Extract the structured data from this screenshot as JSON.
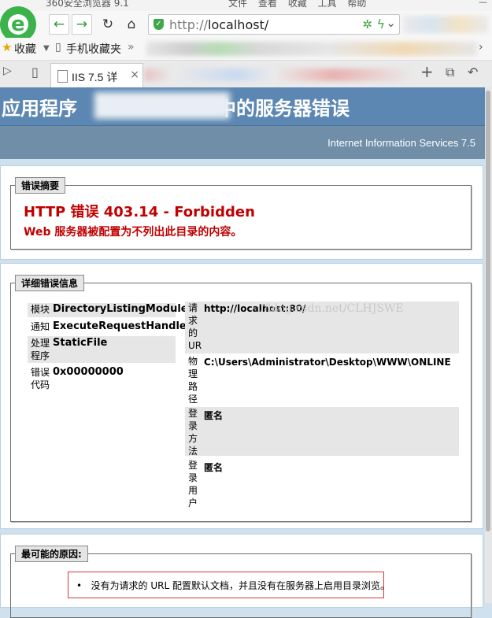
{
  "browser": {
    "title": "360安全浏览器 9.1",
    "menu": [
      "文件",
      "查看",
      "收藏",
      "工具",
      "帮助"
    ],
    "logo_letter": "e",
    "url_protocol": "http://",
    "url_host": "localhost/",
    "buttons": {
      "back": "←",
      "forward": "→",
      "reload": "↻",
      "home": "⌂"
    },
    "favorites": {
      "fav_label": "收藏",
      "mobile_label": "手机收藏夹",
      "more": "»"
    },
    "tab": {
      "label": "IIS 7.5 详",
      "close": "×",
      "new": "+"
    }
  },
  "page": {
    "header_title_start": "应用程序",
    "header_title_end": "中的服务器错误",
    "iis_version": "Internet Information Services 7.5",
    "summary": {
      "legend": "错误摘要",
      "title": "HTTP 错误 403.14 - Forbidden",
      "message": "Web 服务器被配置为不列出此目录的内容。"
    },
    "details": {
      "legend": "详细错误信息",
      "left": [
        {
          "key": "模块",
          "value": "DirectoryListingModule"
        },
        {
          "key": "通知",
          "value": "ExecuteRequestHandler"
        },
        {
          "key": "处理程序",
          "value": "StaticFile"
        },
        {
          "key": "错误代码",
          "value": "0x00000000"
        }
      ],
      "right": [
        {
          "key": "请求的 URL",
          "value": "http://localhost:80/"
        },
        {
          "key": "物理路径",
          "value": "C:\\Users\\Administrator\\Desktop\\WWW\\ONLINE"
        },
        {
          "key": "登录方法",
          "value": "匿名"
        },
        {
          "key": "登录用户",
          "value": "匿名"
        }
      ]
    },
    "watermark": "://blog.csdn.net/CLHJSWE",
    "causes": {
      "legend": "最可能的原因:",
      "items": [
        "没有为请求的 URL 配置默认文档，并且没有在服务器上启用目录浏览。"
      ]
    }
  }
}
